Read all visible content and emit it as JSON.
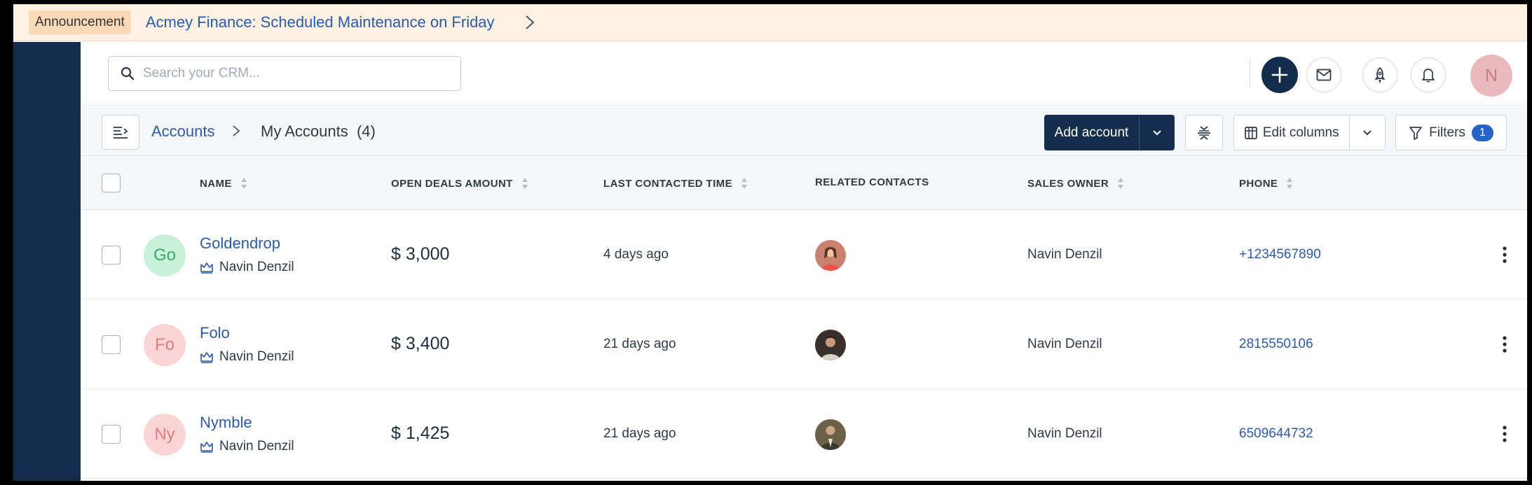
{
  "announcement": {
    "tag": "Announcement",
    "message": "Acmey Finance: Scheduled Maintenance on Friday"
  },
  "header": {
    "search_placeholder": "Search your CRM...",
    "user_initial": "N"
  },
  "toolbar": {
    "breadcrumb_root": "Accounts",
    "breadcrumb_current": "My Accounts",
    "count": "(4)",
    "add_account_label": "Add account",
    "edit_columns_label": "Edit columns",
    "filters_label": "Filters",
    "filters_count": "1"
  },
  "columns": {
    "name": "NAME",
    "open_deals": "OPEN DEALS AMOUNT",
    "last_contacted": "LAST CONTACTED TIME",
    "related_contacts": "RELATED CONTACTS",
    "sales_owner": "SALES OWNER",
    "phone": "PHONE"
  },
  "rows": [
    {
      "initials": "Go",
      "avatar_bg": "#c9f0d8",
      "avatar_fg": "#3aa867",
      "name": "Goldendrop",
      "owner": "Navin Denzil",
      "amount": "$ 3,000",
      "last_contacted": "4 days ago",
      "contact_photo_bg": "#c9826f",
      "sales_owner": "Navin Denzil",
      "phone": "+1234567890"
    },
    {
      "initials": "Fo",
      "avatar_bg": "#fbd5d6",
      "avatar_fg": "#e07b80",
      "name": "Folo",
      "owner": "Navin Denzil",
      "amount": "$ 3,400",
      "last_contacted": "21 days ago",
      "contact_photo_bg": "#3a2f2b",
      "sales_owner": "Navin Denzil",
      "phone": "2815550106"
    },
    {
      "initials": "Ny",
      "avatar_bg": "#fbd5d6",
      "avatar_fg": "#e07b80",
      "name": "Nymble",
      "owner": "Navin Denzil",
      "amount": "$ 1,425",
      "last_contacted": "21 days ago",
      "contact_photo_bg": "#6b6048",
      "sales_owner": "Navin Denzil",
      "phone": "6509644732"
    }
  ],
  "colors": {
    "sidebar": "#152d4c",
    "primary": "#152d4c",
    "link": "#2d5ba8",
    "announcement_bg": "#fdf1e3"
  }
}
